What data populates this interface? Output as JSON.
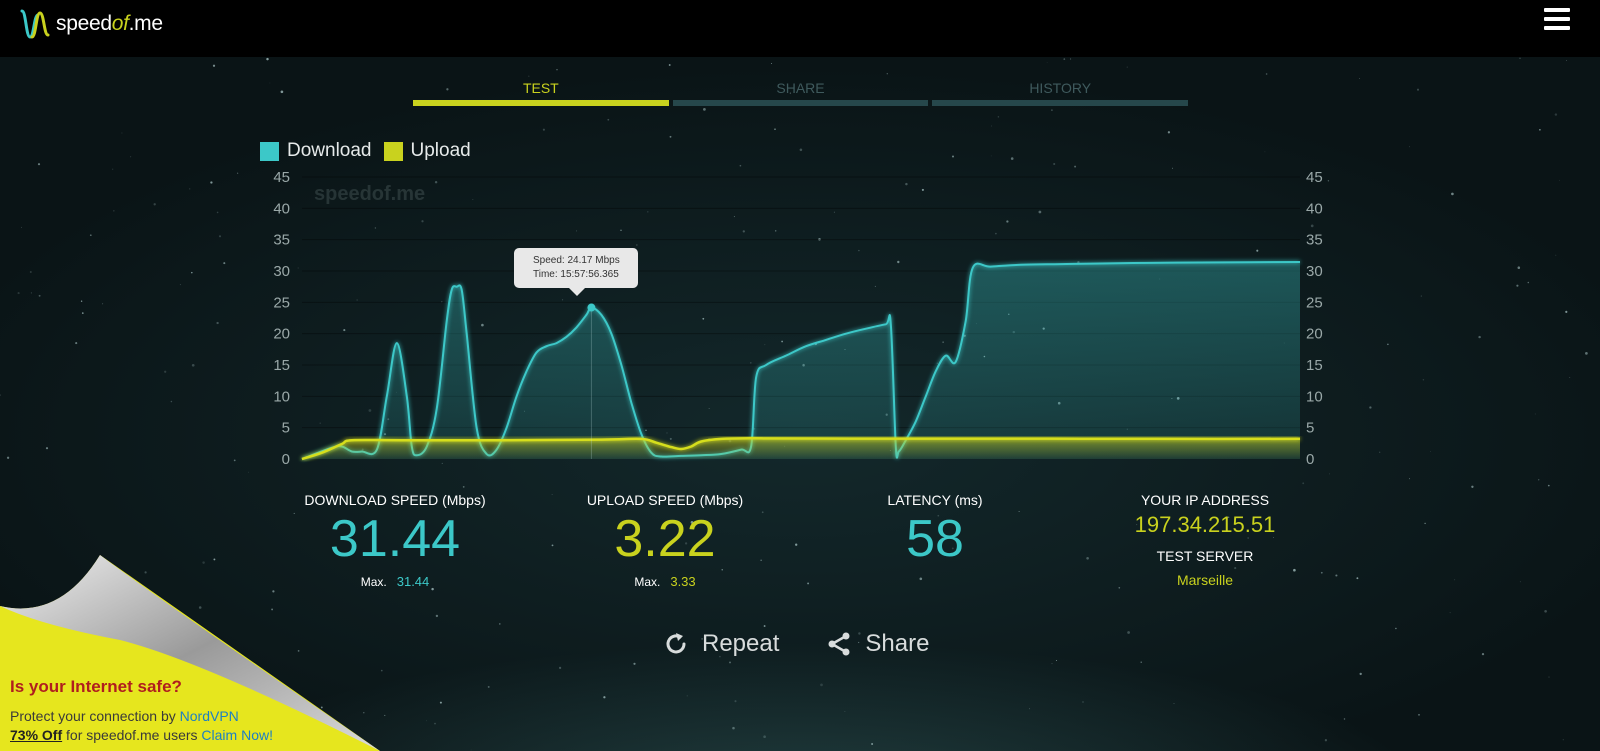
{
  "header": {
    "logo_prefix": "speed",
    "logo_of": "of",
    "logo_suffix": ".me",
    "menu_icon": "hamburger-menu-icon"
  },
  "tabs": [
    {
      "label": "TEST",
      "active": true
    },
    {
      "label": "SHARE",
      "active": false
    },
    {
      "label": "HISTORY",
      "active": false
    }
  ],
  "legend": {
    "download": "Download",
    "upload": "Upload"
  },
  "colors": {
    "download": "#3cc8c8",
    "upload": "#c9d21e",
    "accent": "#c9d21e"
  },
  "watermark": "speedof.me",
  "tooltip": {
    "speed": "Speed: 24.17 Mbps",
    "time": "Time: 15:57:56.365"
  },
  "chart_data": {
    "type": "area",
    "yticks": [
      "0",
      "5",
      "10",
      "15",
      "20",
      "25",
      "30",
      "35",
      "40",
      "45"
    ],
    "ylim": [
      0,
      45
    ],
    "xlim": [
      0,
      100
    ],
    "grid": true,
    "series": [
      {
        "name": "Download",
        "points": [
          [
            0,
            0
          ],
          [
            3,
            1.8
          ],
          [
            4,
            2
          ],
          [
            5,
            1.2
          ],
          [
            6,
            1.2
          ],
          [
            7.5,
            1.5
          ],
          [
            8.5,
            10
          ],
          [
            9.5,
            18.5
          ],
          [
            10.5,
            10
          ],
          [
            11,
            2
          ],
          [
            11.5,
            0.6
          ],
          [
            12.5,
            2
          ],
          [
            13.5,
            8
          ],
          [
            14.5,
            22
          ],
          [
            15,
            27
          ],
          [
            15.5,
            27.5
          ],
          [
            16,
            27
          ],
          [
            16.5,
            20
          ],
          [
            17.5,
            5
          ],
          [
            18.5,
            0.8
          ],
          [
            19.5,
            1.5
          ],
          [
            20.5,
            5
          ],
          [
            21.5,
            10
          ],
          [
            22.5,
            14
          ],
          [
            23.5,
            17
          ],
          [
            24.5,
            18
          ],
          [
            25.5,
            18.5
          ],
          [
            26.5,
            19.5
          ],
          [
            27.5,
            21
          ],
          [
            28.5,
            23
          ],
          [
            29,
            24.17
          ],
          [
            30,
            23
          ],
          [
            31,
            20
          ],
          [
            32,
            15
          ],
          [
            33,
            9
          ],
          [
            34,
            4
          ],
          [
            35,
            1
          ],
          [
            36,
            0.4
          ],
          [
            38,
            0.5
          ],
          [
            40,
            0.6
          ],
          [
            42,
            0.8
          ],
          [
            44,
            1.5
          ],
          [
            45,
            2
          ],
          [
            45.5,
            13
          ],
          [
            46.5,
            15
          ],
          [
            48.5,
            16.5
          ],
          [
            50.5,
            18
          ],
          [
            52.5,
            19
          ],
          [
            54.5,
            20
          ],
          [
            56.5,
            20.8
          ],
          [
            58.5,
            21.5
          ],
          [
            59,
            21.5
          ],
          [
            59.5,
            2
          ],
          [
            59.8,
            1.2
          ],
          [
            60.5,
            3
          ],
          [
            61.5,
            6
          ],
          [
            62.5,
            10
          ],
          [
            63.5,
            14
          ],
          [
            64.5,
            16.5
          ],
          [
            65.5,
            15.5
          ],
          [
            66.5,
            22
          ],
          [
            67.2,
            30.5
          ],
          [
            69,
            30.7
          ],
          [
            72,
            31
          ],
          [
            76,
            31.1
          ],
          [
            80,
            31.2
          ],
          [
            85,
            31.3
          ],
          [
            90,
            31.35
          ],
          [
            95,
            31.4
          ],
          [
            100,
            31.44
          ]
        ]
      },
      {
        "name": "Upload",
        "points": [
          [
            0,
            0
          ],
          [
            2,
            1
          ],
          [
            4,
            2.4
          ],
          [
            5,
            3
          ],
          [
            10,
            3
          ],
          [
            20,
            3
          ],
          [
            30,
            3.1
          ],
          [
            34,
            3.2
          ],
          [
            35.5,
            2.6
          ],
          [
            37,
            1.9
          ],
          [
            38,
            1.6
          ],
          [
            39,
            2
          ],
          [
            40,
            2.8
          ],
          [
            42,
            3.2
          ],
          [
            45,
            3.3
          ],
          [
            55,
            3.25
          ],
          [
            65,
            3.25
          ],
          [
            75,
            3.25
          ],
          [
            85,
            3.22
          ],
          [
            100,
            3.22
          ]
        ]
      }
    ]
  },
  "results": {
    "download": {
      "label": "DOWNLOAD SPEED (Mbps)",
      "value": "31.44",
      "max_label": "Max.",
      "max_value": "31.44"
    },
    "upload": {
      "label": "UPLOAD SPEED (Mbps)",
      "value": "3.22",
      "max_label": "Max.",
      "max_value": "3.33"
    },
    "latency": {
      "label": "LATENCY (ms)",
      "value": "58"
    },
    "ip": {
      "label": "YOUR IP ADDRESS",
      "value": "197.34.215.51",
      "server_label": "TEST SERVER",
      "server_value": "Marseille"
    }
  },
  "actions": {
    "repeat": "Repeat",
    "share": "Share"
  },
  "ad": {
    "title": "Is your Internet safe?",
    "line1_prefix": "Protect your connection by ",
    "line1_link": "NordVPN",
    "line2_off": "73% Off",
    "line2_mid": " for speedof.me users ",
    "line2_link": "Claim Now!"
  }
}
